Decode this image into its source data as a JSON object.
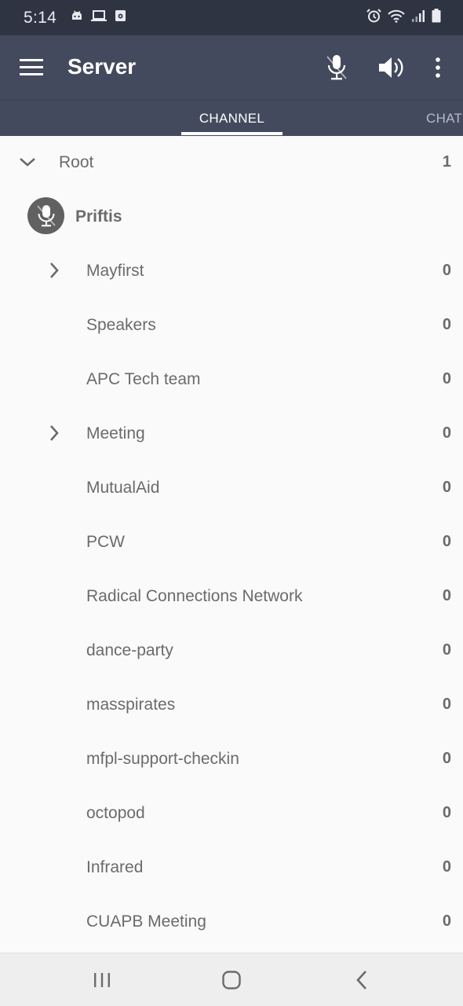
{
  "status_bar": {
    "time": "5:14",
    "left_icons": [
      "android-robot-icon",
      "laptop-icon",
      "square-app-icon"
    ],
    "right_icons": [
      "alarm-icon",
      "wifi-icon",
      "signal-icon",
      "battery-icon"
    ]
  },
  "toolbar": {
    "title": "Server",
    "actions": [
      "microphone-icon",
      "speaker-icon",
      "more-vert-icon"
    ]
  },
  "tabs": [
    {
      "label": "CHANNEL",
      "selected": true
    },
    {
      "label": "CHAT",
      "selected": false
    }
  ],
  "root": {
    "label": "Root",
    "count": "1",
    "expanded": true
  },
  "user": {
    "name": "Priftis",
    "icon": "microphone-icon"
  },
  "channels": [
    {
      "label": "Mayfirst",
      "count": "0",
      "expandable": true
    },
    {
      "label": "Speakers",
      "count": "0",
      "expandable": false
    },
    {
      "label": "APC Tech team",
      "count": "0",
      "expandable": false
    },
    {
      "label": "Meeting",
      "count": "0",
      "expandable": true
    },
    {
      "label": "MutualAid",
      "count": "0",
      "expandable": false
    },
    {
      "label": "PCW",
      "count": "0",
      "expandable": false
    },
    {
      "label": "Radical Connections Network",
      "count": "0",
      "expandable": false
    },
    {
      "label": "dance-party",
      "count": "0",
      "expandable": false
    },
    {
      "label": "masspirates",
      "count": "0",
      "expandable": false
    },
    {
      "label": "mfpl-support-checkin",
      "count": "0",
      "expandable": false
    },
    {
      "label": "octopod",
      "count": "0",
      "expandable": false
    },
    {
      "label": "Infrared",
      "count": "0",
      "expandable": false
    },
    {
      "label": "CUAPB Meeting",
      "count": "0",
      "expandable": false
    }
  ],
  "nav_bar": {
    "buttons": [
      "recent-apps-icon",
      "home-icon",
      "back-icon"
    ]
  },
  "colors": {
    "status_bar": "#2f3442",
    "toolbar": "#434a5d",
    "list_background": "#fafafa",
    "list_text": "#6b6b6b"
  }
}
